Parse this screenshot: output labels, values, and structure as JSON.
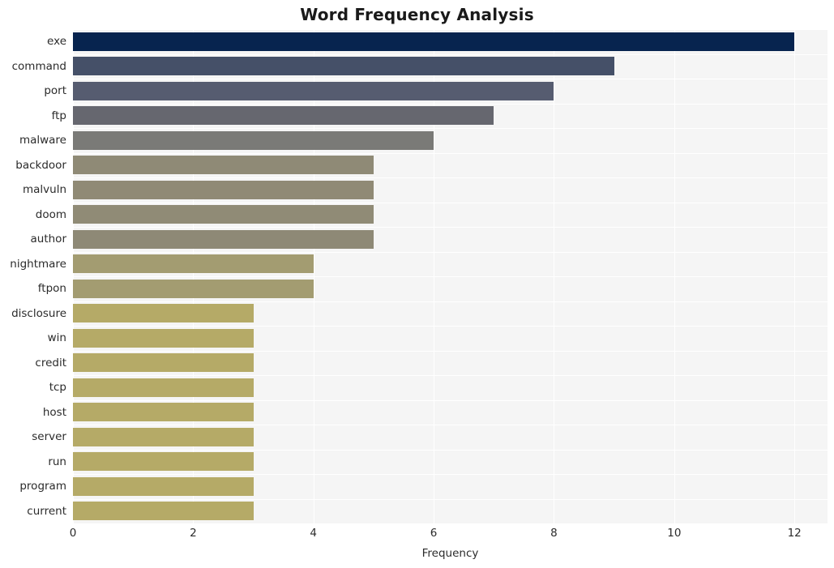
{
  "chart_data": {
    "type": "bar",
    "orientation": "horizontal",
    "title": "Word Frequency Analysis",
    "xlabel": "Frequency",
    "ylabel": "",
    "categories": [
      "exe",
      "command",
      "port",
      "ftp",
      "malware",
      "backdoor",
      "malvuln",
      "doom",
      "author",
      "nightmare",
      "ftpon",
      "disclosure",
      "win",
      "credit",
      "tcp",
      "host",
      "server",
      "run",
      "program",
      "current"
    ],
    "values": [
      12,
      9,
      8,
      7,
      6,
      5,
      5,
      5,
      5,
      4,
      4,
      3,
      3,
      3,
      3,
      3,
      3,
      3,
      3,
      3
    ],
    "xlim": [
      0,
      12.55
    ],
    "xticks": [
      0,
      2,
      4,
      6,
      8,
      10,
      12
    ],
    "xticklabels": [
      "0",
      "2",
      "4",
      "6",
      "8",
      "10",
      "12"
    ],
    "grid": true,
    "grid_color": "#ffffff",
    "plot_background": "#f5f5f5",
    "figure_background": "#ffffff",
    "legend": null,
    "bar_colors": [
      "#07244f",
      "#455068",
      "#565c70",
      "#66676f",
      "#7a7a77",
      "#8f8a76",
      "#908a75",
      "#908b76",
      "#8e8976",
      "#a39c71",
      "#a39c71",
      "#b5aa67",
      "#b5aa67",
      "#b5aa67",
      "#b5aa67",
      "#b5aa67",
      "#b5aa67",
      "#b5aa67",
      "#b5aa67",
      "#b5aa67"
    ]
  }
}
